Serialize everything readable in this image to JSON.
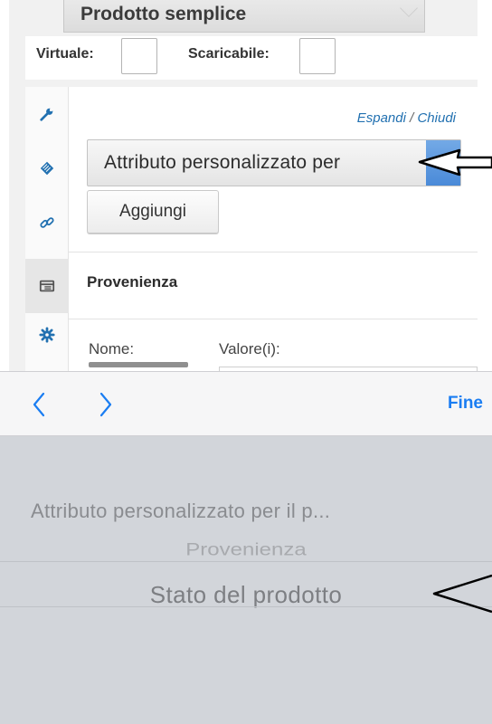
{
  "product": {
    "type_label": "Prodotto semplice",
    "virtual_label": "Virtuale:",
    "downloadable_label": "Scaricabile:"
  },
  "panel": {
    "tabs": [
      {
        "icon": "wrench-icon"
      },
      {
        "icon": "tag-icon"
      },
      {
        "icon": "link-icon"
      },
      {
        "icon": "table-icon",
        "active": true
      },
      {
        "icon": "gear-icon"
      }
    ],
    "expand_label": "Espandi",
    "separator": "/",
    "collapse_label": "Chiudi",
    "attribute_select_value": "Attributo personalizzato per",
    "add_button_label": "Aggiungi",
    "attribute_title": "Provenienza",
    "name_label": "Nome:",
    "values_label": "Valore(i):"
  },
  "picker": {
    "prev_icon": "chevron-left-icon",
    "next_icon": "chevron-right-icon",
    "done_label": "Fine",
    "options": [
      "Attributo personalizzato per il p...",
      "Provenienza",
      "Stato del prodotto"
    ],
    "selected_index": 2
  },
  "colors": {
    "link": "#2271b1",
    "ios_blue": "#1a7df2",
    "select_handle": "#4a8ad8",
    "picker_bg": "#d2d5da"
  }
}
